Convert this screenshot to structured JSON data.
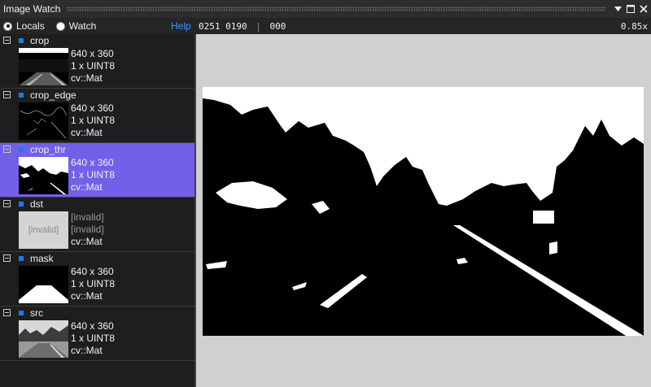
{
  "window": {
    "title": "Image Watch"
  },
  "toolbar": {
    "locals_label": "Locals",
    "watch_label": "Watch",
    "help_label": "Help",
    "coords": "0251 0190",
    "separator": "|",
    "pixel_value": "000",
    "zoom": "0.85x"
  },
  "items": [
    {
      "name": "crop",
      "size": "640 x 360",
      "type": "1 x UINT8",
      "class": "cv::Mat"
    },
    {
      "name": "crop_edge",
      "size": "640 x 360",
      "type": "1 x UINT8",
      "class": "cv::Mat"
    },
    {
      "name": "crop_thr",
      "size": "640 x 360",
      "type": "1 x UINT8",
      "class": "cv::Mat",
      "selected": true
    },
    {
      "name": "dst",
      "size": "[invalid]",
      "type": "[invalid]",
      "class": "cv::Mat",
      "thumb_label": "[invalid]"
    },
    {
      "name": "mask",
      "size": "640 x 360",
      "type": "1 x UINT8",
      "class": "cv::Mat"
    },
    {
      "name": "src",
      "size": "640 x 360",
      "type": "1 x UINT8",
      "class": "cv::Mat"
    }
  ],
  "colors": {
    "selection": "#7160e8",
    "accent": "#1c7ae6",
    "help": "#3399ff"
  },
  "icons": {
    "menu": "triangle-down-icon",
    "maximize": "maximize-icon",
    "close": "close-icon",
    "expander": "collapse-minus-icon"
  }
}
